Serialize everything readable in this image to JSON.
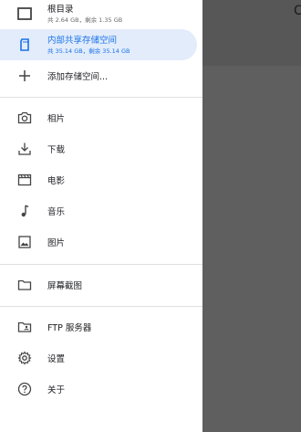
{
  "drawer": {
    "storage": [
      {
        "title": "根目录",
        "sub": "共 2.64 GB，剩余 1.35 GB",
        "icon": "tablet-icon",
        "active": false
      },
      {
        "title": "内部共享存储空间",
        "sub": "共 35.14 GB，剩余 35.14 GB",
        "icon": "sd-card-icon",
        "active": true
      }
    ],
    "add_storage_label": "添加存储空间...",
    "media": [
      "相片",
      "下载",
      "电影",
      "音乐",
      "图片"
    ],
    "screenshots_label": "屏幕截图",
    "ftp_label": "FTP 服务器",
    "settings_label": "设置",
    "about_label": "关于"
  },
  "scrim_glyph": "C",
  "colors": {
    "accent": "#1a73e8",
    "active_bg": "#e3ecfb",
    "scrim": "#5f5f5f"
  }
}
